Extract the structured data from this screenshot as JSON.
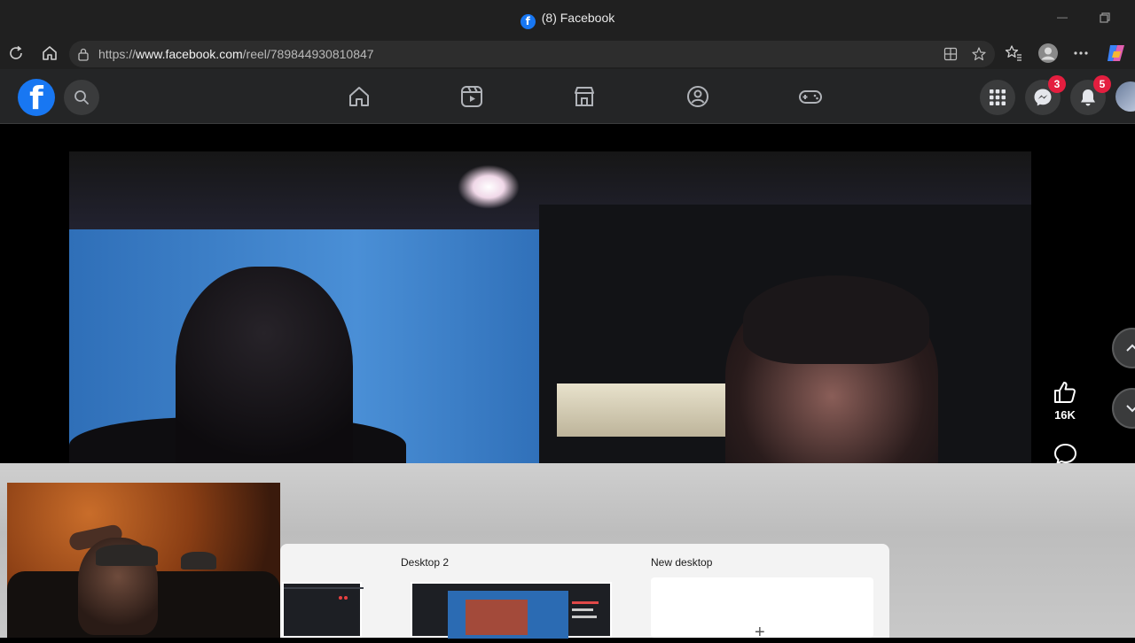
{
  "browser": {
    "tab_title": "(8) Facebook",
    "url_prefix": "https://",
    "url_host": "www.facebook.com",
    "url_path": "/reel/789844930810847"
  },
  "facebook": {
    "logo_letter": "f",
    "messenger_badge": "3",
    "notifications_badge": "5"
  },
  "reel": {
    "like_count": "16K"
  },
  "task_view": {
    "desktop2_label": "Desktop 2",
    "new_desktop_label": "New desktop",
    "plus_symbol": "+"
  },
  "colors": {
    "brand": "#1877f2",
    "badge": "#e41e3f",
    "browser_chrome": "#202020",
    "fb_bar": "#242526"
  }
}
